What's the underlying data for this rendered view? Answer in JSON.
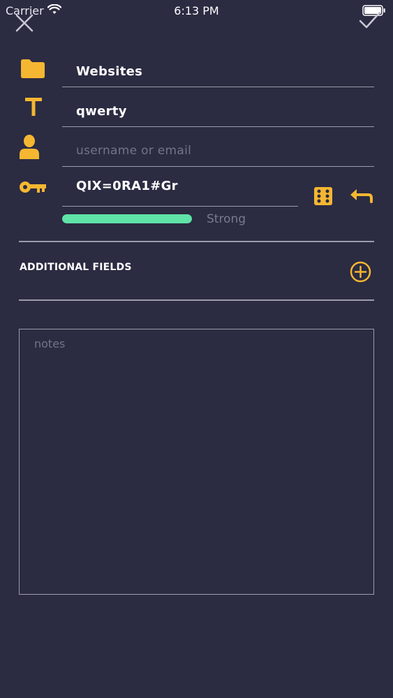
{
  "status_bar": {
    "carrier": "Carrier",
    "time": "6:13 PM"
  },
  "colors": {
    "background": "#2b2b42",
    "accent": "#f5b731",
    "strength": "#5fe3a7",
    "divider": "#9c9cab"
  },
  "icons": {
    "close": "close-icon",
    "confirm": "checkmark-icon",
    "folder": "folder-icon",
    "title": "text-t-icon",
    "user": "user-icon",
    "key": "key-icon",
    "dice": "dice-icon",
    "undo": "undo-icon",
    "add": "plus-circle-icon"
  },
  "form": {
    "folder": {
      "value": "Websites"
    },
    "title": {
      "value": "qwerty"
    },
    "username": {
      "value": "",
      "placeholder": "username or email"
    },
    "password": {
      "value": "QIX=0RA1#Gr"
    },
    "strength": {
      "label": "Strong",
      "fraction": 1.0
    }
  },
  "additional_fields": {
    "label": "ADDITIONAL FIELDS"
  },
  "notes": {
    "placeholder": "notes"
  }
}
